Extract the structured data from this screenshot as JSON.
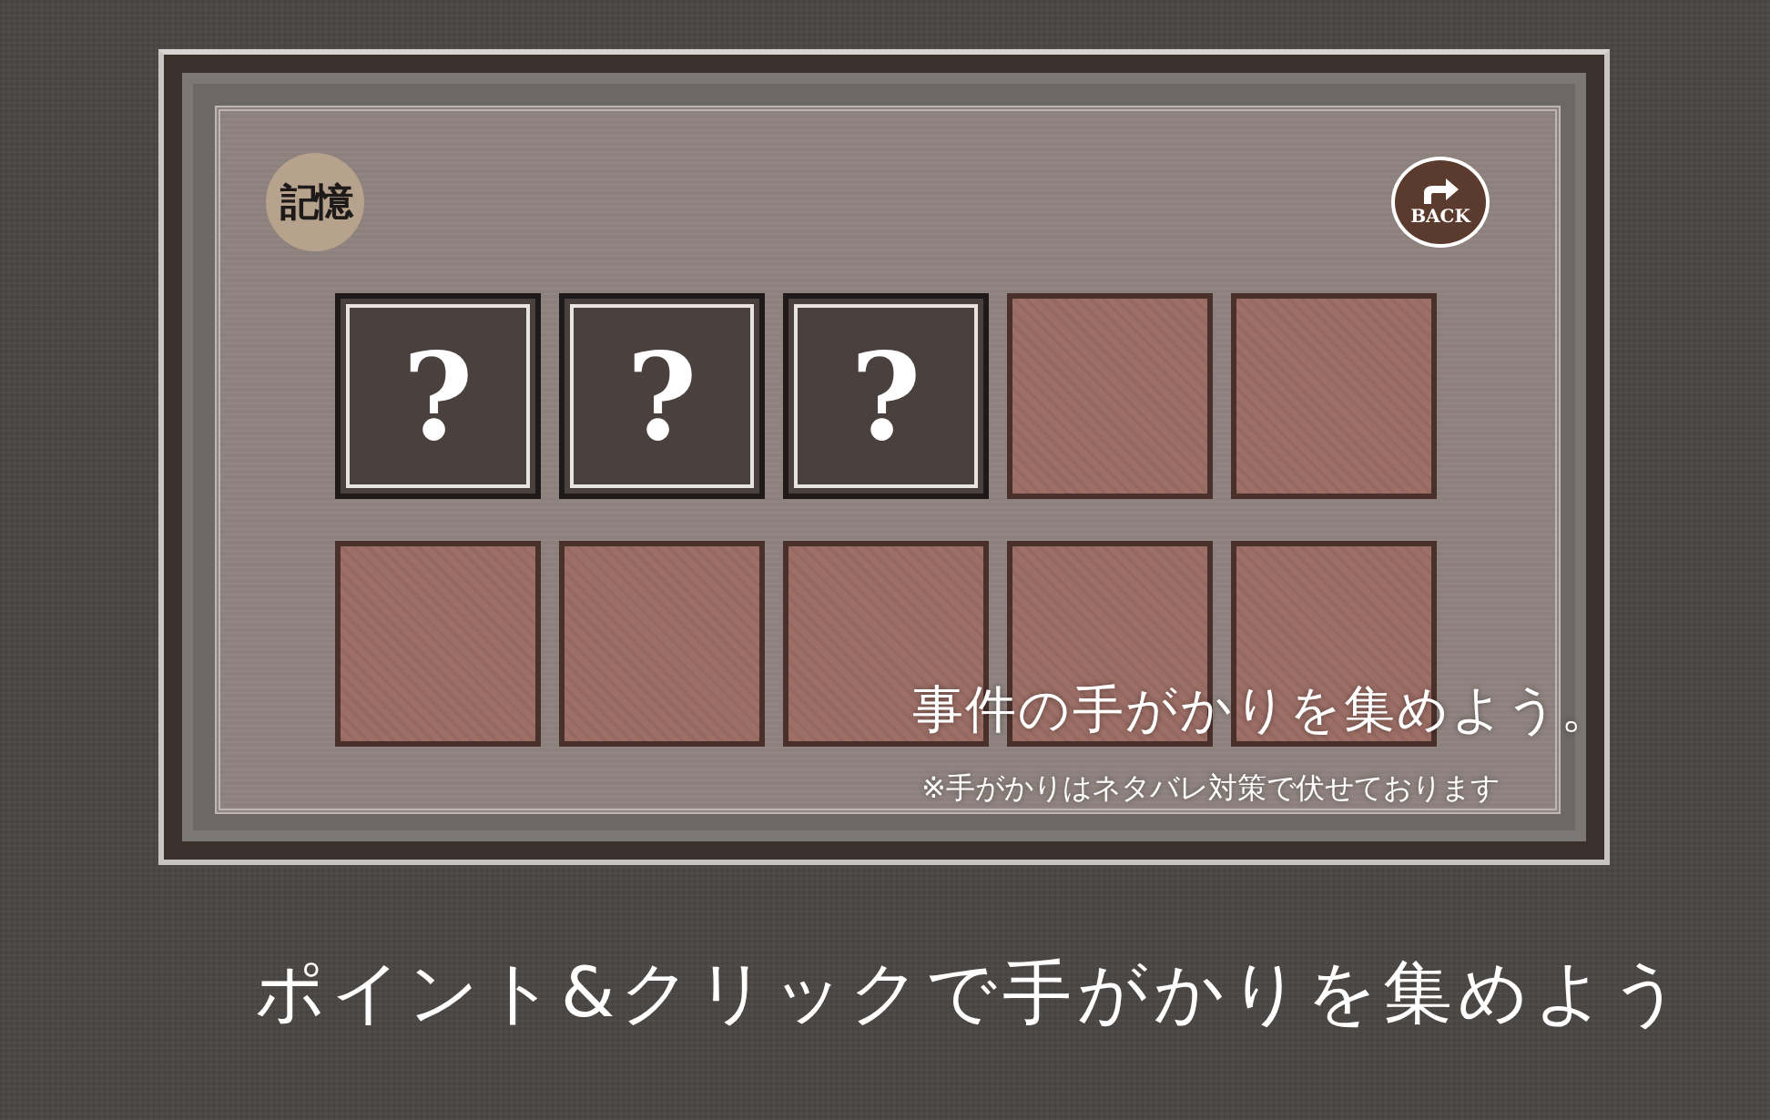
{
  "board": {
    "memory_badge": "記憶",
    "back_button": "BACK",
    "clue_slots": [
      {
        "kind": "hidden",
        "mark": "?"
      },
      {
        "kind": "hidden",
        "mark": "?"
      },
      {
        "kind": "hidden",
        "mark": "?"
      },
      {
        "kind": "empty"
      },
      {
        "kind": "empty"
      },
      {
        "kind": "empty"
      },
      {
        "kind": "empty"
      },
      {
        "kind": "empty"
      },
      {
        "kind": "empty"
      },
      {
        "kind": "empty"
      }
    ],
    "caption": "事件の手がかりを集めよう。",
    "note": "※手がかりはネタバレ対策で伏せております"
  },
  "banner": "ポイント&クリックで手がかりを集めよう"
}
